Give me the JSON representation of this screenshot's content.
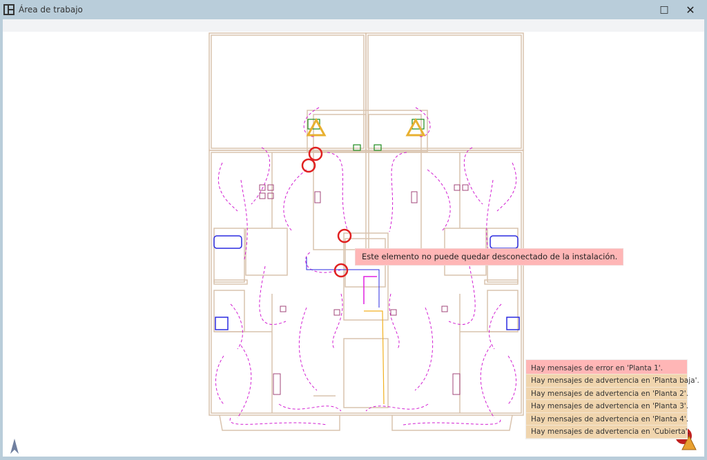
{
  "window": {
    "title": "Área de trabajo",
    "maximize_icon": "□",
    "close_icon": "✕"
  },
  "tooltip": {
    "text": "Este elemento no puede quedar desconectado de la instalación."
  },
  "messages": [
    {
      "text": "Hay mensajes de error en 'Planta 1'.",
      "type": "error"
    },
    {
      "text": "Hay mensajes de advertencia en 'Planta baja'.",
      "type": "warning"
    },
    {
      "text": "Hay mensajes de advertencia en 'Planta 2'.",
      "type": "warning"
    },
    {
      "text": "Hay mensajes de advertencia en 'Planta 3'.",
      "type": "warning"
    },
    {
      "text": "Hay mensajes de advertencia en 'Planta 4'.",
      "type": "warning"
    },
    {
      "text": "Hay mensajes de advertencia en 'Cubierta'.",
      "type": "warning"
    }
  ],
  "colors": {
    "wall": "#d9c3ad",
    "circuit": "#d21fd2",
    "error": "#e02020",
    "warning": "#e8b030",
    "tooltip": "#ffb6b6",
    "warning_bg": "#f0d5ae"
  }
}
